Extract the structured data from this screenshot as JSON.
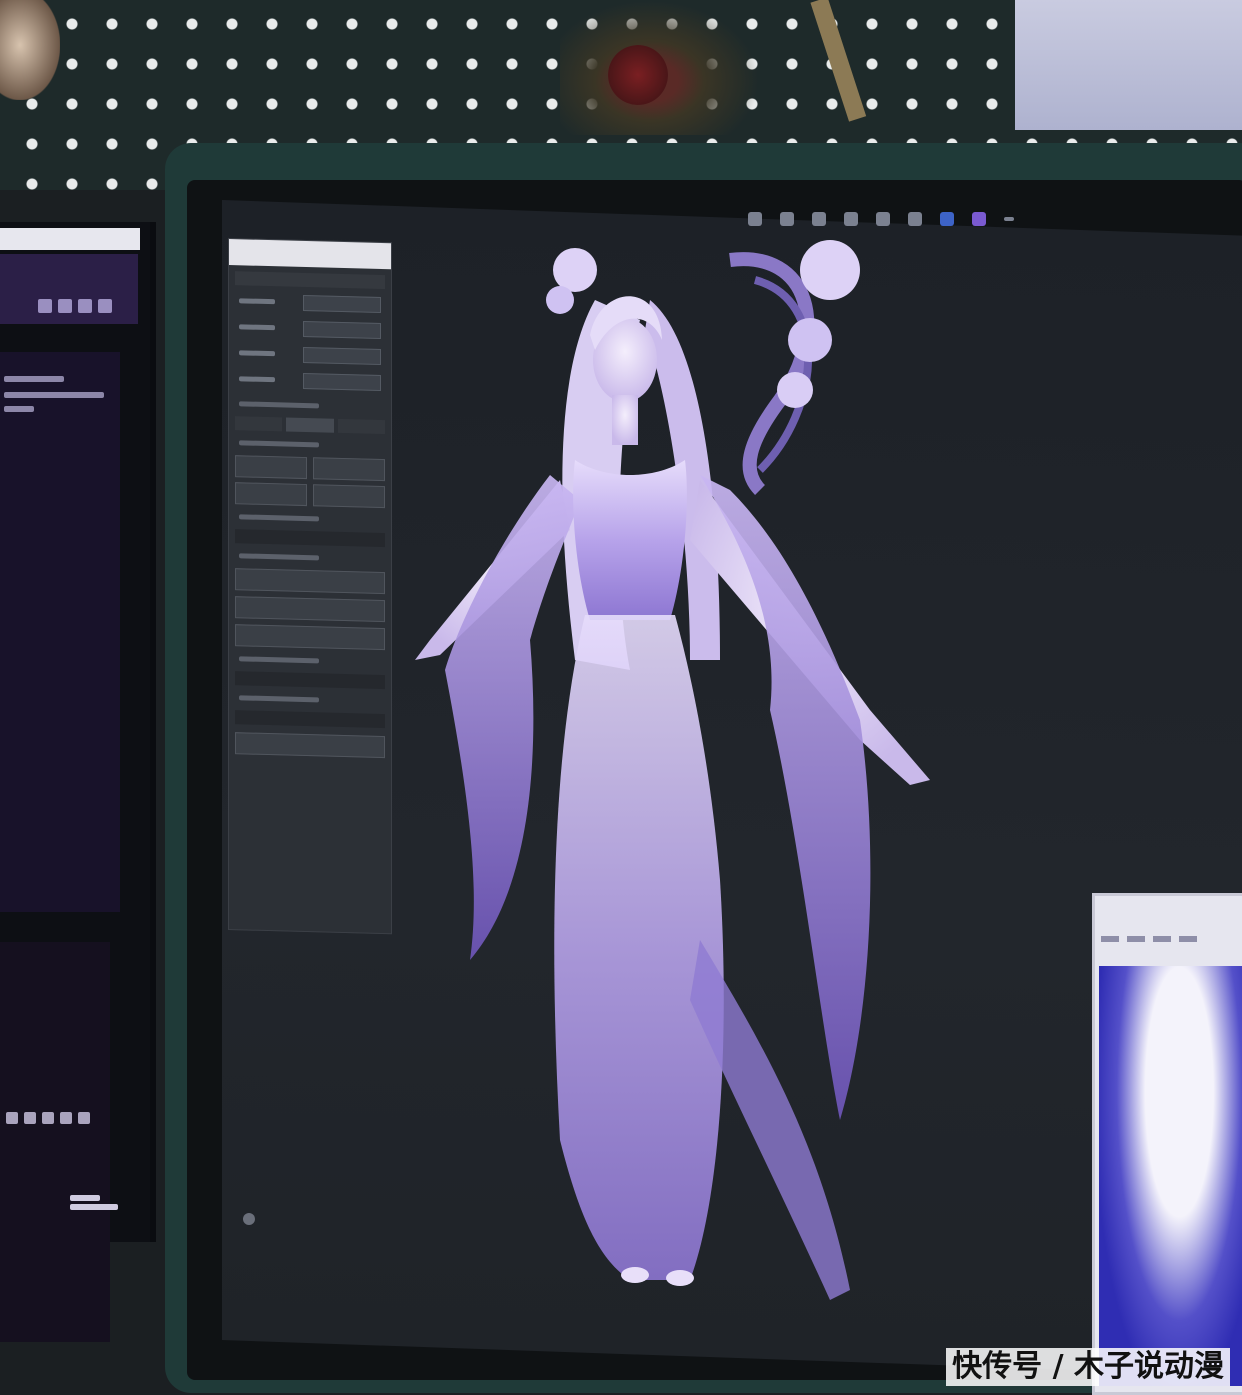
{
  "watermark": {
    "text": "快传号 / 木子说动漫"
  },
  "colors": {
    "bezel": "#1f3a38",
    "viewport": "#22262c",
    "character_primary": "#b9a6e8",
    "character_shadow": "#7a63c4",
    "character_highlight": "#efe8ff"
  },
  "icons": [
    "toolbar-icons",
    "panel-icons"
  ]
}
